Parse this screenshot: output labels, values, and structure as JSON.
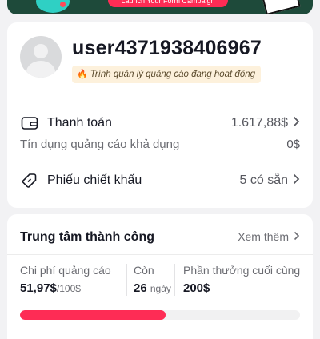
{
  "banner": {
    "cta_label": "Launch Your Form Campaign"
  },
  "account": {
    "username": "user4371938406967",
    "status_badge": "Trình quản lý quảng cáo đang hoạt động",
    "payment_label": "Thanh toán",
    "payment_value": "1.617,88$",
    "credit_label": "Tín dụng quảng cáo khả dụng",
    "credit_value": "0$",
    "voucher_label": "Phiếu chiết khấu",
    "voucher_value": "5 có sẵn"
  },
  "success_center": {
    "title": "Trung tâm thành công",
    "more_label": "Xem thêm",
    "spend_label": "Chi phí quảng cáo",
    "spend_value": "51,97$",
    "spend_target": "/100$",
    "remaining_label": "Còn",
    "remaining_value": "26",
    "remaining_unit": "ngày",
    "reward_label": "Phần thưởng cuối cùng",
    "reward_value": "200$",
    "progress_fraction": 0.52,
    "progress_color": "#fe2c55"
  },
  "icons": [
    "flame-icon",
    "wallet-icon",
    "coupon-icon",
    "chevron-right-icon"
  ]
}
